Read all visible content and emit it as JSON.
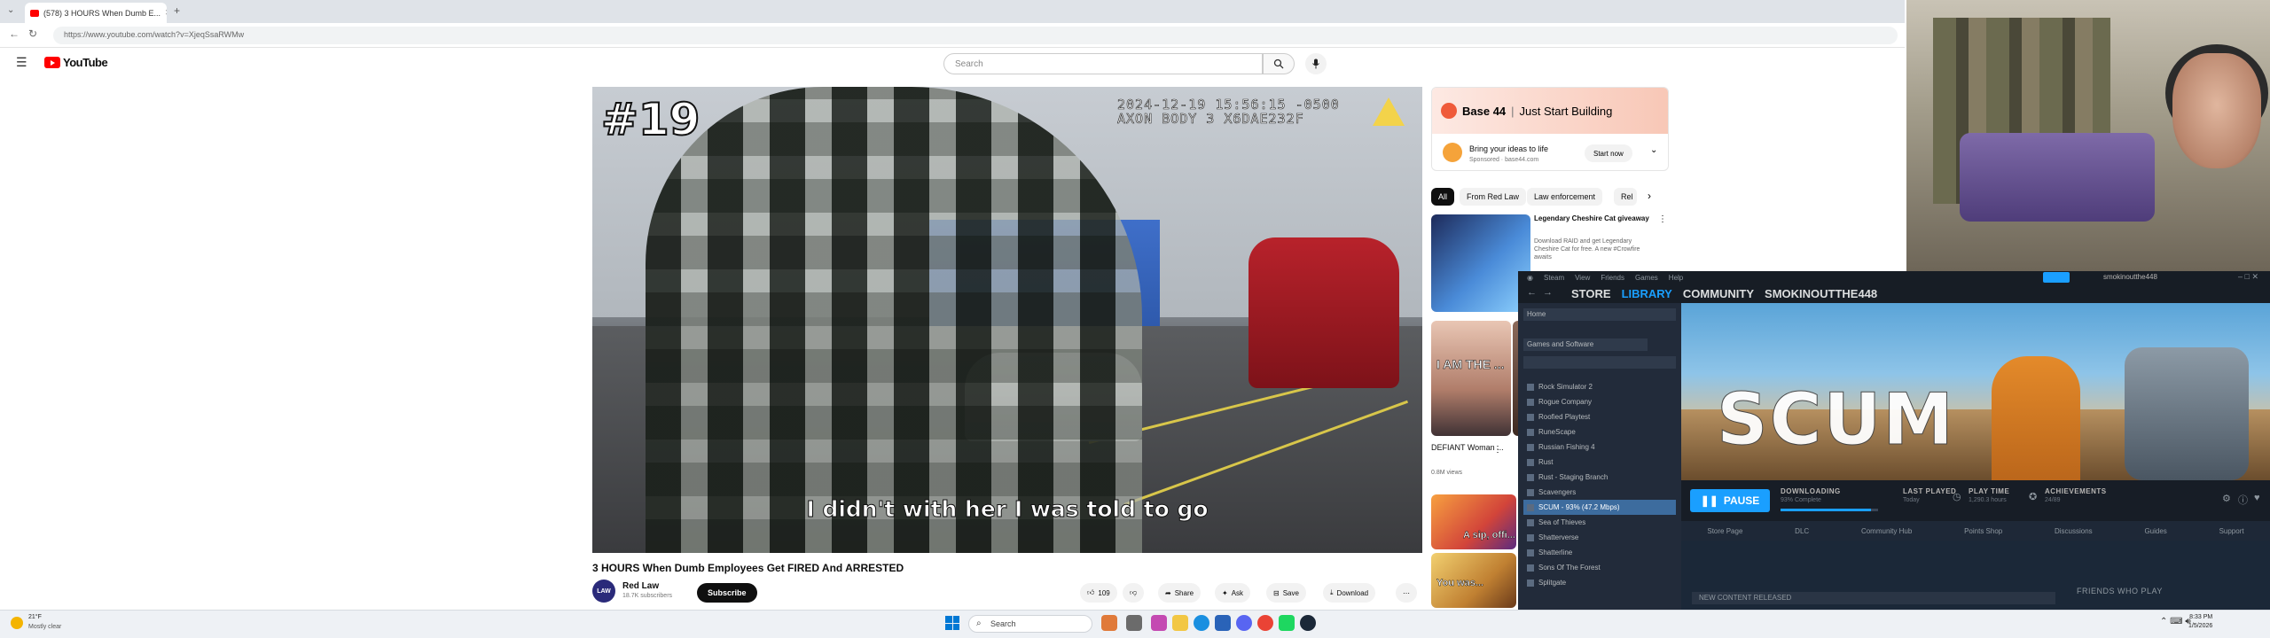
{
  "browser": {
    "tab_title": "(578) 3 HOURS When Dumb E...",
    "url": "https://www.youtube.com/watch?v=XjeqSsaRWMw",
    "new_tab": "+"
  },
  "youtube": {
    "logo_text": "YouTube",
    "search_placeholder": "Search",
    "player": {
      "episode_number": "#19",
      "timestamp_line1": "2024-12-19 15:56:15 -0500",
      "timestamp_line2": "AXON BODY 3 X6DAE232F",
      "caption": "I didn't with her I was told to go"
    },
    "video_title": "3 HOURS When Dumb Employees Get FIRED And ARRESTED",
    "channel": {
      "avatar_text": "LAW",
      "name": "Red Law",
      "subscribers": "18.7K subscribers",
      "subscribe_label": "Subscribe"
    },
    "actions": {
      "likes": "109",
      "share": "Share",
      "ask": "Ask",
      "save": "Save",
      "download": "Download"
    },
    "ad": {
      "brand": "Base 44",
      "tagline": "Just Start Building",
      "line1": "Bring your ideas to life",
      "line2": "Sponsored · base44.com",
      "cta": "Start now"
    },
    "chips": [
      "All",
      "From Red Law",
      "Law enforcement",
      "Rel"
    ],
    "recommendations": [
      {
        "title": "Legendary Cheshire Cat giveaway",
        "desc": "Download RAID and get Legendary Cheshire Cat for free. A new #Crowfire awaits"
      },
      {
        "thumb_text": "I AM THE ...",
        "title": "DEFIANT Woman ...",
        "views": "0.8M views"
      },
      {
        "thumb_text": "A sip, offi..."
      },
      {
        "thumb_text": "You was..."
      }
    ]
  },
  "steam": {
    "menu": [
      "Steam",
      "View",
      "Friends",
      "Games",
      "Help"
    ],
    "nav": [
      "STORE",
      "LIBRARY",
      "COMMUNITY",
      "SMOKINOUTTHE448"
    ],
    "account": "smokinoutthe448",
    "home_label": "Home",
    "filter_label": "Games and Software",
    "games": [
      "Rock Simulator 2",
      "Rogue Company",
      "Roofied Playtest",
      "RuneScape",
      "Russian Fishing 4",
      "Rust",
      "Rust - Staging Branch",
      "Scavengers",
      "SCUM - 93% (47.2 Mbps)",
      "Sea of Thieves",
      "Shatterverse",
      "Shatterline",
      "Sons Of The Forest",
      "Splitgate"
    ],
    "selected_game_index": 8,
    "hero_logo": "SCUM",
    "pause_label": "PAUSE",
    "downloading_label": "DOWNLOADING",
    "downloading_sub": "93% Complete",
    "download_progress": 0.93,
    "last_played_label": "LAST PLAYED",
    "last_played_sub": "Today",
    "play_time_label": "PLAY TIME",
    "play_time_sub": "1,290.3 hours",
    "achievements_label": "ACHIEVEMENTS",
    "achievements_sub": "24/89",
    "subnav": [
      "Store Page",
      "DLC",
      "Community Hub",
      "Points Shop",
      "Discussions",
      "Guides",
      "Support"
    ],
    "news_label": "NEW CONTENT RELEASED",
    "friends_label": "FRIENDS WHO PLAY"
  },
  "taskbar": {
    "weather_temp": "21°F",
    "weather_cond": "Mostly clear",
    "search_label": "Search",
    "clock_time": "8:33 PM",
    "clock_date": "1/5/2026"
  },
  "colors": {
    "youtube_red": "#ff0000",
    "steam_blue": "#1a9fff",
    "steam_bg": "#1b2838"
  }
}
